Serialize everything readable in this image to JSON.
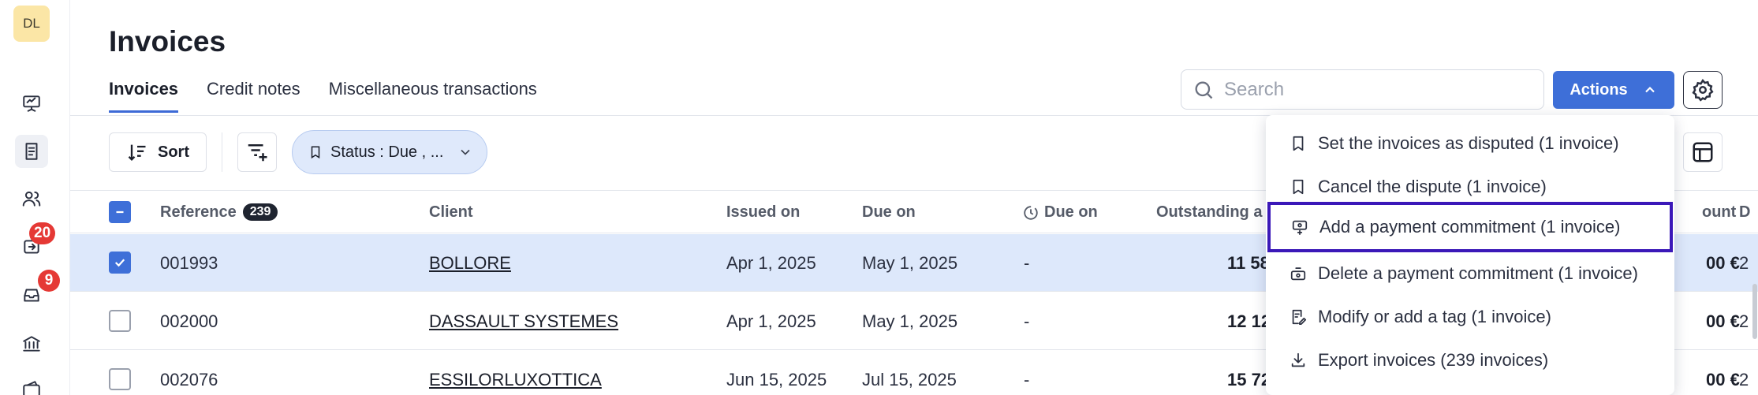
{
  "user": {
    "initials": "DL"
  },
  "sidebar": {
    "badges": {
      "reminders": "20",
      "inbox": "9"
    },
    "icons": [
      "presentation-icon",
      "invoice-icon",
      "users-icon",
      "reminders-icon",
      "inbox-icon",
      "bank-icon",
      "wallet-icon"
    ]
  },
  "page": {
    "title": "Invoices"
  },
  "tabs": [
    {
      "label": "Invoices",
      "active": true
    },
    {
      "label": "Credit notes",
      "active": false
    },
    {
      "label": "Miscellaneous transactions",
      "active": false
    }
  ],
  "search": {
    "placeholder": "Search",
    "value": ""
  },
  "toolbar": {
    "actions_label": "Actions",
    "sort_label": "Sort",
    "status_filter_label": "Status : Due , ..."
  },
  "table": {
    "headers": {
      "reference": "Reference",
      "reference_count": "239",
      "client": "Client",
      "issued_on": "Issued on",
      "due_on": "Due on",
      "due_on_forecast": "Due on",
      "outstanding": "Outstanding a",
      "amount": "ount",
      "last": "D"
    },
    "rows": [
      {
        "selected": true,
        "reference": "001993",
        "client": "BOLLORE",
        "issued_on": "Apr 1, 2025",
        "due_on": "May 1, 2025",
        "due_on_forecast": "-",
        "outstanding": "11 58",
        "amount": "00 €",
        "last": "2"
      },
      {
        "selected": false,
        "reference": "002000",
        "client": "DASSAULT SYSTEMES",
        "issued_on": "Apr 1, 2025",
        "due_on": "May 1, 2025",
        "due_on_forecast": "-",
        "outstanding": "12 12",
        "amount": "00 €",
        "last": "2"
      },
      {
        "selected": false,
        "reference": "002076",
        "client": "ESSILORLUXOTTICA",
        "issued_on": "Jun 15, 2025",
        "due_on": "Jul 15, 2025",
        "due_on_forecast": "-",
        "outstanding": "15 72",
        "amount": "00 €",
        "last": "2"
      }
    ]
  },
  "actions_menu": {
    "items": [
      {
        "label": "Set the invoices as disputed (1 invoice)",
        "icon": "bookmark-icon"
      },
      {
        "label": "Cancel the dispute (1 invoice)",
        "icon": "bookmark-icon"
      },
      {
        "label": "Add a payment commitment (1 invoice)",
        "icon": "payment-commitment-add-icon",
        "focused": true
      },
      {
        "label": "Delete a payment commitment (1 invoice)",
        "icon": "payment-commitment-delete-icon"
      },
      {
        "label": "Modify or add a tag (1 invoice)",
        "icon": "tag-edit-icon"
      },
      {
        "label": "Export invoices (239 invoices)",
        "icon": "download-icon"
      }
    ]
  },
  "colors": {
    "accent": "#3e6fd8",
    "selected_row": "#dde8fb",
    "badge": "#e53935",
    "focus_outline": "#3b18b8"
  }
}
